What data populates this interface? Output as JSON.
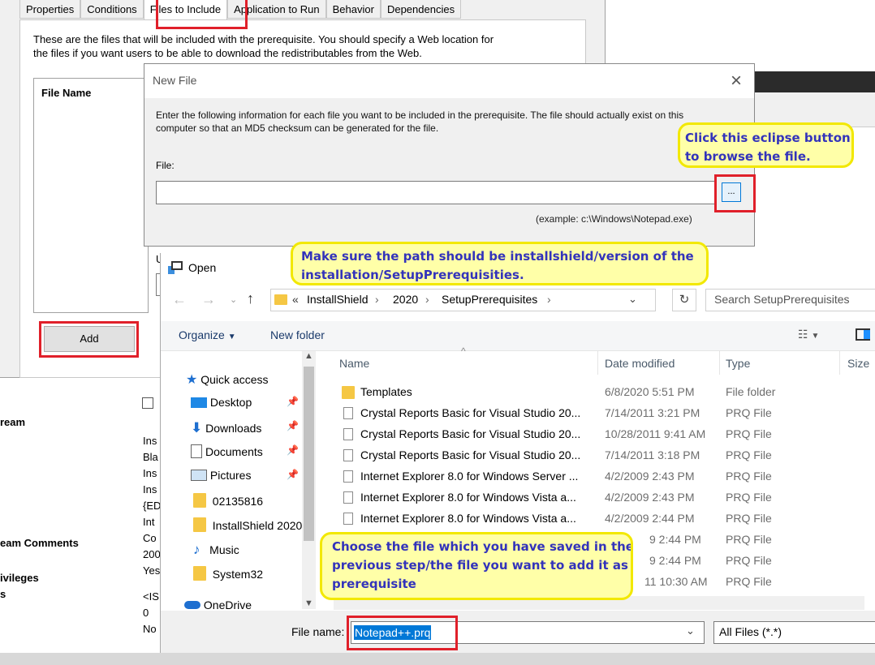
{
  "bg_editor": {
    "tabs": [
      "Properties",
      "Conditions",
      "Files to Include",
      "Application to Run",
      "Behavior",
      "Dependencies"
    ],
    "description": [
      "These are the files that will be included with the prerequisite. You should specify a Web location for",
      "the files if you want users to be able to download the redistributables from the Web."
    ],
    "list_header": "File Name",
    "add_label": "Add",
    "left_props": [
      "ream",
      "eam Comments",
      "ivileges",
      "s"
    ],
    "mid_values": [
      "Ins",
      "Bla",
      "Ins",
      "Ins",
      "{ED",
      "Int",
      "Co",
      "200",
      "Yes",
      "<IS",
      "0",
      "No"
    ]
  },
  "new_file": {
    "title": "New File",
    "close": "×",
    "instructions": [
      "Enter the following information for each file you want to be included in the prerequisite. The file should actually exist on this",
      "computer so that an MD5 checksum can be generated for the file."
    ],
    "file_label": "File:",
    "file_value": "",
    "browse_label": "...",
    "example": "(example: c:\\Windows\\Notepad.exe)",
    "partial_label": "U"
  },
  "open_dialog": {
    "title": "Open",
    "breadcrumb": [
      "«",
      "InstallShield",
      "2020",
      "SetupPrerequisites"
    ],
    "search_placeholder": "Search SetupPrerequisites",
    "organize": "Organize",
    "new_folder": "New folder",
    "nav": [
      {
        "label": "Quick access",
        "icon": "star-icon"
      },
      {
        "label": "Desktop",
        "icon": "desktop-icon",
        "pinned": true
      },
      {
        "label": "Downloads",
        "icon": "download-icon",
        "pinned": true
      },
      {
        "label": "Documents",
        "icon": "documents-icon",
        "pinned": true
      },
      {
        "label": "Pictures",
        "icon": "pictures-icon",
        "pinned": true
      },
      {
        "label": "02135816",
        "icon": "folder-icon"
      },
      {
        "label": "InstallShield 2020",
        "icon": "folder-icon"
      },
      {
        "label": "Music",
        "icon": "music-icon"
      },
      {
        "label": "System32",
        "icon": "folder-icon"
      },
      {
        "label": "OneDrive",
        "icon": "cloud-icon"
      }
    ],
    "columns": [
      "Name",
      "Date modified",
      "Type",
      "Size"
    ],
    "files": [
      {
        "name": "Templates",
        "date": "6/8/2020 5:51 PM",
        "type": "File folder",
        "icon": "folder-icon"
      },
      {
        "name": "Crystal Reports Basic for Visual Studio 20...",
        "date": "7/14/2011 3:21 PM",
        "type": "PRQ File",
        "icon": "file-icon"
      },
      {
        "name": "Crystal Reports Basic for Visual Studio 20...",
        "date": "10/28/2011 9:41 AM",
        "type": "PRQ File",
        "icon": "file-icon"
      },
      {
        "name": "Crystal Reports Basic for Visual Studio 20...",
        "date": "7/14/2011 3:18 PM",
        "type": "PRQ File",
        "icon": "file-icon"
      },
      {
        "name": "Internet Explorer 8.0 for Windows Server ...",
        "date": "4/2/2009 2:43 PM",
        "type": "PRQ File",
        "icon": "file-icon"
      },
      {
        "name": "Internet Explorer 8.0 for Windows Vista a...",
        "date": "4/2/2009 2:43 PM",
        "type": "PRQ File",
        "icon": "file-icon"
      },
      {
        "name": "Internet Explorer 8.0 for Windows Vista a...",
        "date": "4/2/2009 2:44 PM",
        "type": "PRQ File",
        "icon": "file-icon"
      },
      {
        "name": "",
        "date": "9 2:44 PM",
        "type": "PRQ File",
        "icon": ""
      },
      {
        "name": "",
        "date": "9 2:44 PM",
        "type": "PRQ File",
        "icon": ""
      },
      {
        "name": "",
        "date": "11 10:30 AM",
        "type": "PRQ File",
        "icon": ""
      }
    ],
    "file_name_label": "File name:",
    "file_name_value": "Notepad++.prq",
    "file_type_value": "All Files (*.*)"
  },
  "callouts": {
    "eclipse": [
      "Click this eclipse button",
      "to browse the file."
    ],
    "path": [
      "Make sure the path should be installshield/version of the",
      "installation/SetupPrerequisities."
    ],
    "choose": [
      "Choose the file which you have saved in the",
      "previous step/the file you want to add it as",
      "prerequisite"
    ]
  },
  "colors": {
    "annotation_red": "#e0202a",
    "callout_fill": "#ffffa8",
    "callout_border": "#f2e800",
    "callout_text": "#3333bb",
    "selection": "#0078d7"
  }
}
